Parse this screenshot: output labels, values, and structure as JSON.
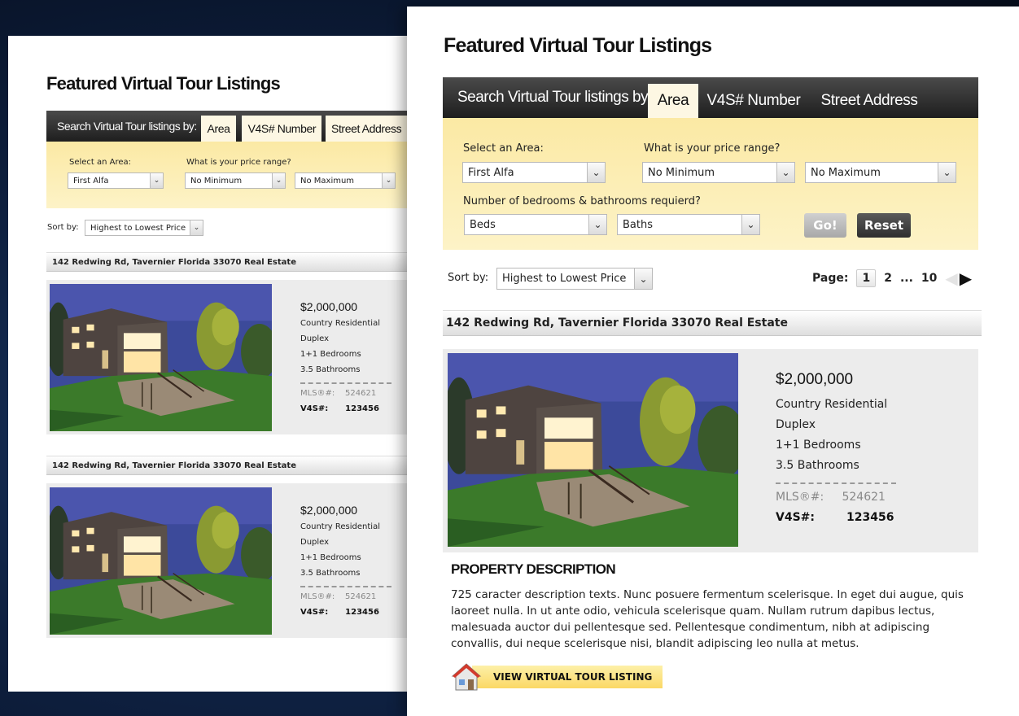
{
  "page": {
    "title": "Featured Virtual Tour Listings"
  },
  "search": {
    "lead": "Search Virtual Tour listings by:",
    "tabs": [
      "Area",
      "V4S# Number",
      "Street Address"
    ],
    "area_label": "Select an Area:",
    "area_value": "First Alfa",
    "price_label": "What is your price range?",
    "price_min": "No Minimum",
    "price_max": "No Maximum",
    "rooms_label": "Number of bedrooms & bathrooms requierd?",
    "beds": "Beds",
    "baths": "Baths",
    "go": "Go!",
    "reset": "Reset"
  },
  "sort": {
    "label": "Sort by:",
    "value": "Highest to Lowest Price"
  },
  "pager": {
    "label": "Page:",
    "current": "1",
    "next": "2",
    "ellipsis": "...",
    "last": "10"
  },
  "listing": {
    "address": "142 Redwing Rd, Tavernier Florida 33070 Real Estate",
    "price": "$2,000,000",
    "type": "Country Residential",
    "style": "Duplex",
    "bedrooms": "1+1 Bedrooms",
    "bathrooms": "3.5 Bathrooms",
    "mls_label": "MLS®#:",
    "mls_value": "524621",
    "v4s_label": "V4S#:",
    "v4s_value": "123456"
  },
  "description": {
    "heading": "PROPERTY DESCRIPTION",
    "text": "725 caracter description texts. Nunc posuere fermentum scelerisque. In eget dui augue, quis laoreet nulla. In ut ante odio, vehicula scelerisque quam. Nullam rutrum dapibus lectus, malesuada auctor dui pellentesque sed. Pellentesque condimentum, nibh at adipiscing convallis, dui neque scelerisque nisi, blandit adipiscing leo nulla at metus.",
    "cta": "VIEW VIRTUAL TOUR LISTING"
  },
  "icons": {
    "dropdown": "chevron-down-icon",
    "prev": "arrow-left-icon",
    "next": "arrow-right-icon",
    "house": "house-icon"
  },
  "colors": {
    "tabbar": "#2a2a2a",
    "search_bg": "#fbe9a4",
    "go_button": "#bdbdbd",
    "reset_button": "#4a4a4a",
    "cta_bg": "#fde68a"
  }
}
